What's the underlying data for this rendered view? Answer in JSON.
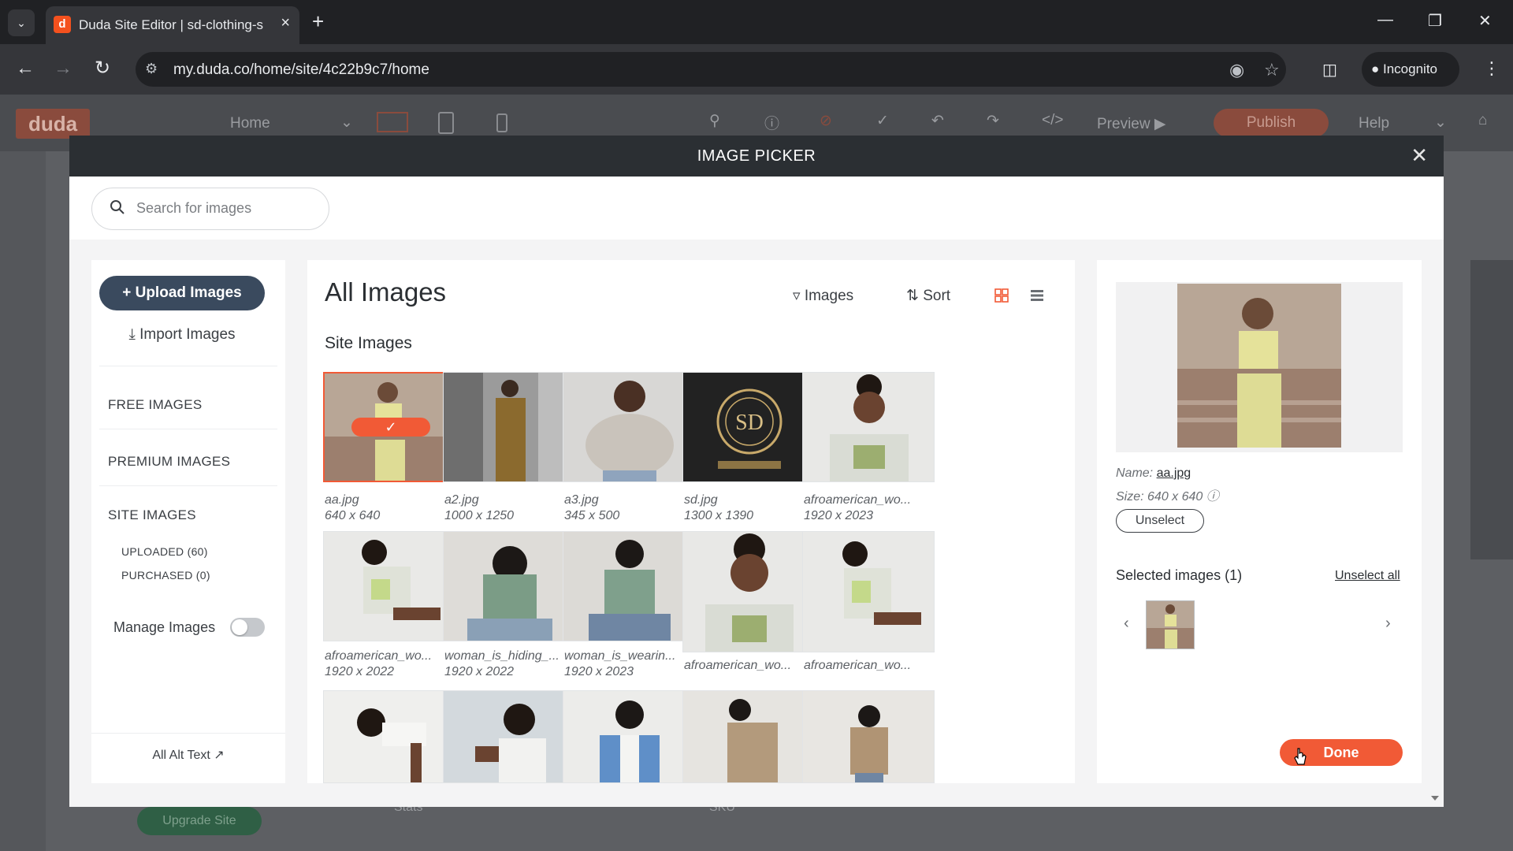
{
  "browser": {
    "tab_title": "Duda Site Editor | sd-clothing-s",
    "url": "my.duda.co/home/site/4c22b9c7/home",
    "incognito_label": "Incognito"
  },
  "editor": {
    "logo": "duda",
    "page_select": "Home",
    "preview": "Preview",
    "publish": "Publish",
    "help": "Help",
    "upgrade": "Upgrade Site",
    "bottom_labels": [
      "Stats",
      "SKU"
    ]
  },
  "modal": {
    "title": "IMAGE PICKER",
    "search_placeholder": "Search for images",
    "left": {
      "upload": "Upload Images",
      "import": "Import Images",
      "free_images": "FREE IMAGES",
      "premium_images": "PREMIUM IMAGES",
      "site_images": "SITE IMAGES",
      "uploaded": "UPLOADED (60)",
      "purchased": "PURCHASED (0)",
      "manage_images": "Manage Images",
      "manage_images_on": false,
      "all_alt_text": "All Alt Text"
    },
    "center": {
      "title": "All Images",
      "section": "Site Images",
      "filter_label": "Images",
      "sort_label": "Sort",
      "view_mode": "grid",
      "images": [
        {
          "name": "aa.jpg",
          "size": "640 x 640",
          "selected": true
        },
        {
          "name": "a2.jpg",
          "size": "1000 x 1250",
          "selected": false
        },
        {
          "name": "a3.jpg",
          "size": "345 x 500",
          "selected": false
        },
        {
          "name": "sd.jpg",
          "size": "1300 x 1390",
          "selected": false
        },
        {
          "name": "afroamerican_wo...",
          "size": "1920 x 2023",
          "selected": false
        },
        {
          "name": "afroamerican_wo...",
          "size": "1920 x 2022",
          "selected": false
        },
        {
          "name": "woman_is_hiding_...",
          "size": "1920 x 2022",
          "selected": false
        },
        {
          "name": "woman_is_wearin...",
          "size": "1920 x 2023",
          "selected": false
        },
        {
          "name": "afroamerican_wo...",
          "size": "",
          "selected": false
        },
        {
          "name": "afroamerican_wo...",
          "size": "",
          "selected": false
        },
        {
          "name": "",
          "size": "",
          "selected": false
        },
        {
          "name": "",
          "size": "",
          "selected": false
        },
        {
          "name": "",
          "size": "",
          "selected": false
        },
        {
          "name": "",
          "size": "",
          "selected": false
        },
        {
          "name": "",
          "size": "",
          "selected": false
        }
      ]
    },
    "right": {
      "name_label": "Name:",
      "name_value": "aa.jpg",
      "size_label": "Size:",
      "size_value": "640 x 640",
      "unselect": "Unselect",
      "selected_title": "Selected images (1)",
      "unselect_all": "Unselect all",
      "done": "Done"
    }
  },
  "colors": {
    "accent": "#f15a36",
    "upload_bg": "#3a4a5e",
    "modal_header": "#2b2f33"
  }
}
